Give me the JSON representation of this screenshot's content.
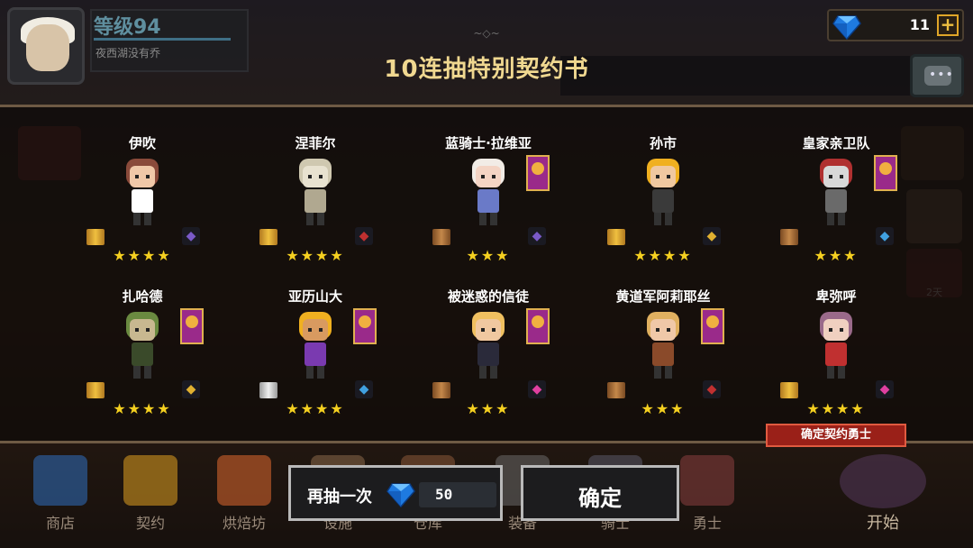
{
  "player": {
    "level_label": "等级94",
    "subtitle": "夜西湖没有乔"
  },
  "currency": {
    "gem_count": "11",
    "add_label": "+"
  },
  "header": {
    "title": "10连抽特别契约书"
  },
  "heroes": [
    {
      "name": "伊吹",
      "stars": "★★★★",
      "scroll": "gold",
      "weapon_icon": "staff-icon",
      "weapon_color": "#7a5ac8",
      "banner": false
    },
    {
      "name": "涅菲尔",
      "stars": "★★★★",
      "scroll": "gold",
      "weapon_icon": "sword-icon",
      "weapon_color": "#c03030",
      "banner": false
    },
    {
      "name": "蓝骑士·拉维亚",
      "stars": "★★★",
      "scroll": "bronze",
      "weapon_icon": "staff-icon",
      "weapon_color": "#7a5ac8",
      "banner": true
    },
    {
      "name": "孙市",
      "stars": "★★★★",
      "scroll": "gold",
      "weapon_icon": "rifle-icon",
      "weapon_color": "#e0b030",
      "banner": false
    },
    {
      "name": "皇家亲卫队",
      "stars": "★★★",
      "scroll": "bronze",
      "weapon_icon": "axe-icon",
      "weapon_color": "#40a0e0",
      "banner": true
    },
    {
      "name": "扎哈德",
      "stars": "★★★★",
      "scroll": "gold",
      "weapon_icon": "rifle-icon",
      "weapon_color": "#e0b030",
      "banner": true
    },
    {
      "name": "亚历山大",
      "stars": "★★★★",
      "scroll": "white",
      "weapon_icon": "axe-icon",
      "weapon_color": "#40a0e0",
      "banner": true
    },
    {
      "name": "被迷惑的信徒",
      "stars": "★★★",
      "scroll": "bronze",
      "weapon_icon": "orb-icon",
      "weapon_color": "#e040a0",
      "banner": true
    },
    {
      "name": "黄道军阿莉耶丝",
      "stars": "★★★",
      "scroll": "bronze",
      "weapon_icon": "sword-icon",
      "weapon_color": "#c03030",
      "banner": true
    },
    {
      "name": "卑弥呼",
      "stars": "★★★★",
      "scroll": "gold",
      "weapon_icon": "orb-icon",
      "weapon_color": "#e040a0",
      "banner": false
    }
  ],
  "new_badge": "确定契约勇士",
  "actions": {
    "redraw_label": "再抽一次",
    "redraw_cost": "50",
    "confirm_label": "确定"
  },
  "bottom_nav": [
    {
      "label": "商店"
    },
    {
      "label": "契约"
    },
    {
      "label": "烘焙坊"
    },
    {
      "label": "设施"
    },
    {
      "label": "仓库"
    },
    {
      "label": "装备"
    },
    {
      "label": "骑士"
    },
    {
      "label": "勇士"
    }
  ],
  "start_label": "开始",
  "side": {
    "timer_label": "2天"
  },
  "colors": {
    "title": "#f0d890",
    "star": "#f5d020",
    "panel_border": "#6e5a44",
    "badge": "#9a2018"
  }
}
